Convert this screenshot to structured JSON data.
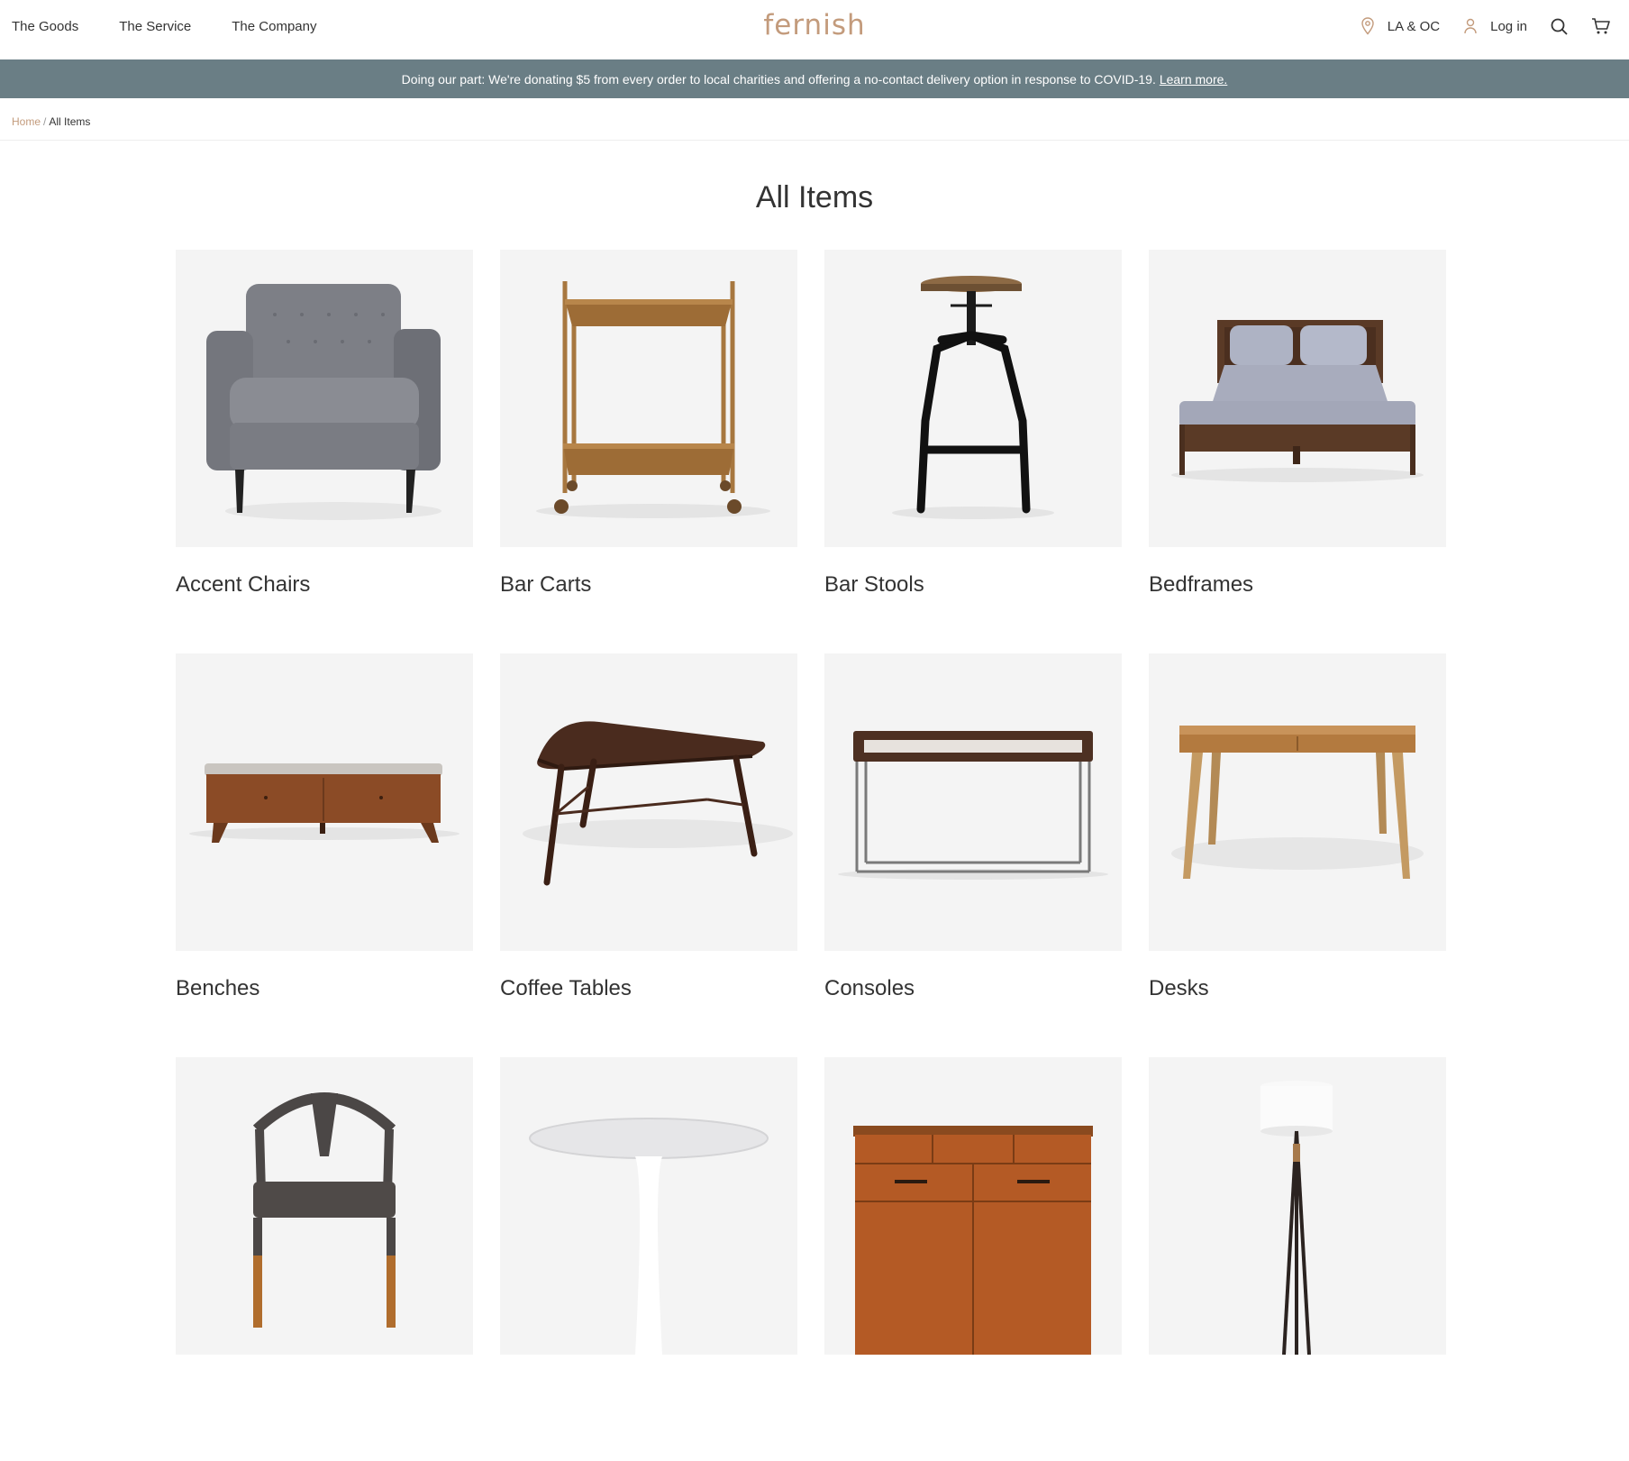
{
  "nav": {
    "left_links": [
      "The Goods",
      "The Service",
      "The Company"
    ],
    "logo": "fernish",
    "location": "LA & OC",
    "login": "Log in"
  },
  "banner": {
    "text": "Doing our part: We're donating $5 from every order to local charities and offering a no-contact delivery option in response to COVID-19.",
    "link": "Learn more."
  },
  "breadcrumb": {
    "home": "Home",
    "separator": "/",
    "current": "All Items"
  },
  "page_title": "All Items",
  "categories": [
    {
      "label": "Accent Chairs",
      "icon": "accent-chair-image"
    },
    {
      "label": "Bar Carts",
      "icon": "bar-cart-image"
    },
    {
      "label": "Bar Stools",
      "icon": "bar-stool-image"
    },
    {
      "label": "Bedframes",
      "icon": "bedframe-image"
    },
    {
      "label": "Benches",
      "icon": "bench-image"
    },
    {
      "label": "Coffee Tables",
      "icon": "coffee-table-image"
    },
    {
      "label": "Consoles",
      "icon": "console-image"
    },
    {
      "label": "Desks",
      "icon": "desk-image"
    },
    {
      "label": "",
      "icon": "dining-chair-image"
    },
    {
      "label": "",
      "icon": "dining-table-image"
    },
    {
      "label": "",
      "icon": "dresser-image"
    },
    {
      "label": "",
      "icon": "floor-lamp-image"
    }
  ],
  "colors": {
    "brand": "#c39b7c",
    "banner": "#6a7e85",
    "tile": "#f4f4f4"
  }
}
